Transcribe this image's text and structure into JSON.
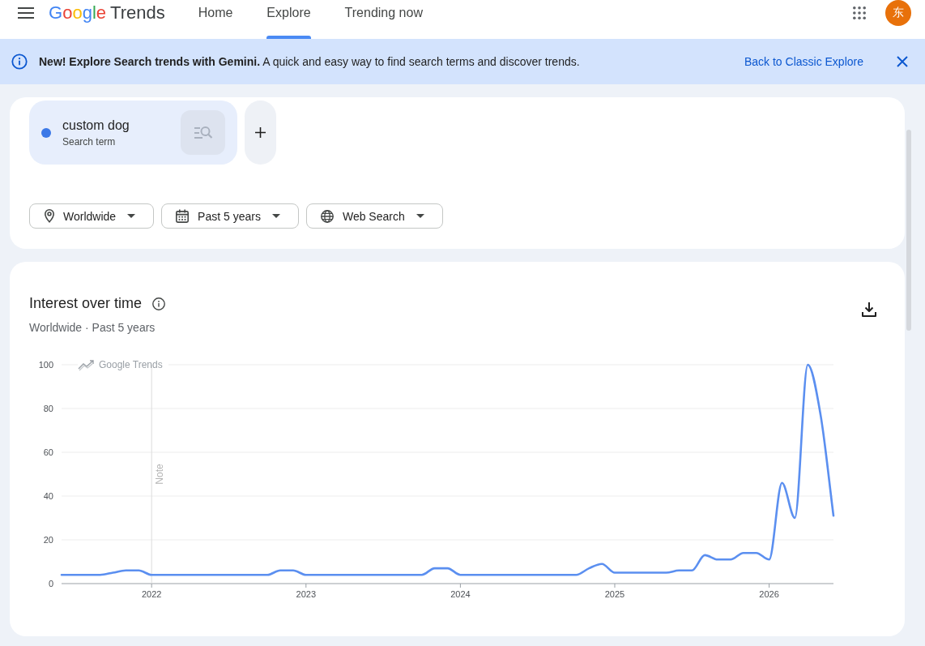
{
  "header": {
    "logo": {
      "brand": "Google",
      "product": "Trends"
    },
    "nav": [
      {
        "label": "Home",
        "selected": false
      },
      {
        "label": "Explore",
        "selected": true
      },
      {
        "label": "Trending now",
        "selected": false
      }
    ],
    "avatar": "东"
  },
  "banner": {
    "message": "**New! Explore Search trends with Gemini.** A quick and easy way to find search terms and discover trends.",
    "link": "Back to Classic Explore"
  },
  "search_card": {
    "terms": [
      {
        "name": "custom dog",
        "type": "Search term",
        "color": "#3b78e7"
      }
    ],
    "filters": [
      {
        "kind": "location",
        "label": "Worldwide"
      },
      {
        "kind": "date",
        "label": "Past 5 years"
      },
      {
        "kind": "property",
        "label": "Web Search"
      }
    ]
  },
  "interest_card": {
    "title": "Interest over time",
    "subtitle": "Worldwide · Past 5 years",
    "chart_brand": "Google Trends",
    "chart_data": {
      "type": "line",
      "x": [
        "2021-06",
        "2021-07",
        "2021-08",
        "2021-09",
        "2021-10",
        "2021-11",
        "2021-12",
        "2022-01",
        "2022-02",
        "2022-03",
        "2022-04",
        "2022-05",
        "2022-06",
        "2022-07",
        "2022-08",
        "2022-09",
        "2022-10",
        "2022-11",
        "2022-12",
        "2023-01",
        "2023-02",
        "2023-03",
        "2023-04",
        "2023-05",
        "2023-06",
        "2023-07",
        "2023-08",
        "2023-09",
        "2023-10",
        "2023-11",
        "2023-12",
        "2024-01",
        "2024-02",
        "2024-03",
        "2024-04",
        "2024-05",
        "2024-06",
        "2024-07",
        "2024-08",
        "2024-09",
        "2024-10",
        "2024-11",
        "2024-12",
        "2025-01",
        "2025-02",
        "2025-03",
        "2025-04",
        "2025-05",
        "2025-06",
        "2025-07",
        "2025-08",
        "2025-09",
        "2025-10",
        "2025-11",
        "2025-12",
        "2026-01",
        "2026-02",
        "2026-03",
        "2026-04",
        "2026-05",
        "2026-06"
      ],
      "series": [
        {
          "color": "#5b8ff0",
          "values": [
            4,
            4,
            4,
            4,
            5,
            6,
            6,
            4,
            4,
            4,
            4,
            4,
            4,
            4,
            4,
            4,
            4,
            6,
            6,
            4,
            4,
            4,
            4,
            4,
            4,
            4,
            4,
            4,
            4,
            7,
            7,
            4,
            4,
            4,
            4,
            4,
            4,
            4,
            4,
            4,
            4,
            7,
            9,
            5,
            5,
            5,
            5,
            5,
            6,
            6,
            13,
            11,
            11,
            14,
            14,
            11,
            46,
            30,
            100,
            77,
            31
          ]
        }
      ],
      "xlim": [
        "2021-06",
        "2026-06"
      ],
      "ylim": [
        0,
        100
      ],
      "yticks": [
        0,
        20,
        40,
        60,
        80,
        100
      ],
      "xticks": [
        {
          "value": "2022-01",
          "label": "2022"
        },
        {
          "value": "2023-01",
          "label": "2023"
        },
        {
          "value": "2024-01",
          "label": "2024"
        },
        {
          "value": "2025-01",
          "label": "2025"
        },
        {
          "value": "2026-01",
          "label": "2026"
        }
      ],
      "grid": true,
      "ref_lines": [
        {
          "axis": "x",
          "value": "2022-01",
          "label": "Note"
        }
      ]
    }
  }
}
